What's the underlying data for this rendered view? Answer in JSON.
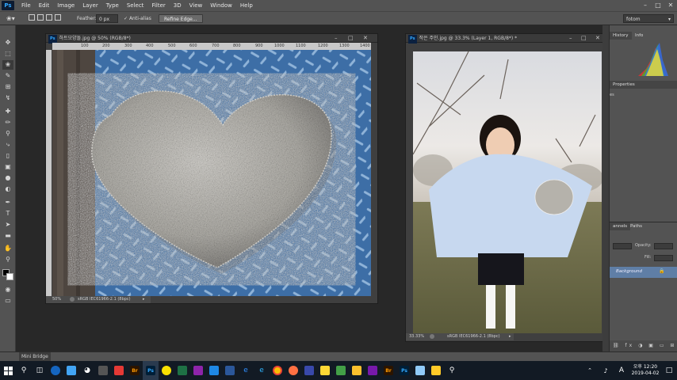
{
  "app": {
    "logo": "Ps"
  },
  "menu": [
    "File",
    "Edit",
    "Image",
    "Layer",
    "Type",
    "Select",
    "Filter",
    "3D",
    "View",
    "Window",
    "Help"
  ],
  "options": {
    "feather_label": "Feather:",
    "feather_value": "0 px",
    "antialias_label": "Anti-alias",
    "antialias_checked": true,
    "refine_label": "Refine Edge...",
    "workspace": "fotom"
  },
  "doc1": {
    "title": "하트모양돌.jpg @ 50% (RGB/8*)",
    "zoom": "50%",
    "profile": "sRGB IEC61966-2.1 (8bpc)",
    "ruler": [
      "100",
      "200",
      "300",
      "400",
      "500",
      "600",
      "700",
      "800",
      "900",
      "1000",
      "1100",
      "1200",
      "1300",
      "1400"
    ]
  },
  "doc2": {
    "title": "작은 주인.jpg @ 33.3% (Layer 1, RGB/8*) *",
    "zoom": "33.33%",
    "profile": "sRGB IEC61966-2.1 (8bpc)"
  },
  "panels": {
    "history_tab": "History",
    "info_tab": "Info",
    "properties_tab": "Properties",
    "layers_tab": "annels",
    "paths_tab": "Paths",
    "opacity_label": "Opacity:",
    "fill_label": "Fill:",
    "layer_name": "Background"
  },
  "mini_bridge": "Mini Bridge",
  "taskbar": {
    "time": "오후 12:20",
    "date": "2019-04-02",
    "ime": "A",
    "apps": [
      {
        "label": "Br",
        "bg": "#2b1400",
        "fg": "#ff9a00"
      },
      {
        "label": "Ps",
        "bg": "#001e36",
        "fg": "#31a8ff"
      },
      {
        "label": "Ps",
        "bg": "#001e36",
        "fg": "#31a8ff"
      },
      {
        "label": "Br",
        "bg": "#2b1400",
        "fg": "#ff9a00"
      },
      {
        "label": "Ps",
        "bg": "#001e36",
        "fg": "#31a8ff"
      }
    ]
  },
  "colors": {
    "accent": "#31a8ff",
    "ui_bg": "#535353",
    "canvas_bg": "#282828"
  }
}
